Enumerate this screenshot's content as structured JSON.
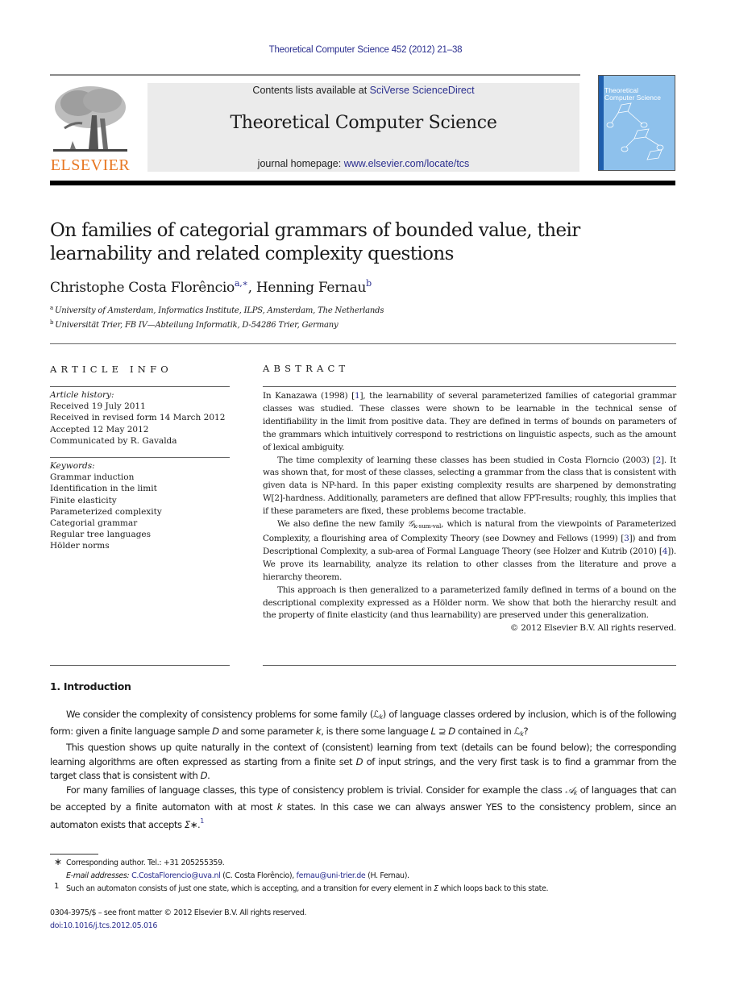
{
  "running_head": "Theoretical Computer Science 452 (2012) 21–38",
  "masthead": {
    "publisher_logo_text": "ELSEVIER",
    "contents_prefix": "Contents lists available at ",
    "contents_link": "SciVerse ScienceDirect",
    "journal_title": "Theoretical Computer Science",
    "homepage_prefix": "journal homepage: ",
    "homepage_link": "www.elsevier.com/locate/tcs",
    "cover_title_line1": "Theoretical",
    "cover_title_line2": "Computer Science",
    "colors": {
      "link": "#2b2f8f",
      "elsevier_orange": "#e87722",
      "banner_bg": "#ebebeb",
      "cover_bg": "#8ec1ec",
      "cover_spine": "#1f5fae"
    }
  },
  "article": {
    "title": "On families of categorial grammars of bounded value, their learnability and related complexity questions",
    "authors": [
      {
        "name": "Christophe Costa Florêncio",
        "marks": "a,∗"
      },
      {
        "name": "Henning Fernau",
        "marks": "b"
      }
    ],
    "author_separator": ", ",
    "affiliations": [
      {
        "mark": "a",
        "text": "University of Amsterdam, Informatics Institute, ILPS, Amsterdam, The Netherlands"
      },
      {
        "mark": "b",
        "text": "Universität Trier, FB IV—Abteilung Informatik, D-54286 Trier, Germany"
      }
    ]
  },
  "article_info": {
    "heading": "ARTICLE INFO",
    "history_label": "Article history:",
    "history": [
      "Received 19 July 2011",
      "Received in revised form 14 March 2012",
      "Accepted 12 May 2012",
      "Communicated by R. Gavalda"
    ],
    "keywords_label": "Keywords:",
    "keywords": [
      "Grammar induction",
      "Identification in the limit",
      "Finite elasticity",
      "Parameterized complexity",
      "Categorial grammar",
      "Regular tree languages",
      "Hölder norms"
    ]
  },
  "abstract": {
    "heading": "ABSTRACT",
    "p1_a": "In Kanazawa (1998) [",
    "p1_ref": "1",
    "p1_b": "], the learnability of several parameterized families of categorial grammar classes was studied. These classes were shown to be learnable in the technical sense of identifiability in the limit from positive data. They are defined in terms of bounds on parameters of the grammars which intuitively correspond to restrictions on linguistic aspects, such as the amount of lexical ambiguity.",
    "p2_a": "The time complexity of learning these classes has been studied in Costa Florncio (2003) [",
    "p2_ref": "2",
    "p2_b": "]. It was shown that, for most of these classes, selecting a grammar from the class that is consistent with given data is NP-hard. In this paper existing complexity results are sharpened by demonstrating W[2]-hardness. Additionally, parameters are defined that allow FPT-results; roughly, this implies that if these parameters are fixed, these problems become tractable.",
    "p3_a": "We also define the new family ",
    "p3_sym": "𝒢",
    "p3_sub": "k-sum-val",
    "p3_b": ", which is natural from the viewpoints of Parameterized Complexity, a flourishing area of Complexity Theory (see Downey and Fellows (1999) [",
    "p3_ref1": "3",
    "p3_c": "]) and from Descriptional Complexity, a sub-area of Formal Language Theory (see Holzer and Kutrib (2010) [",
    "p3_ref2": "4",
    "p3_d": "]). We prove its learnability, analyze its relation to other classes from the literature and prove a hierarchy theorem.",
    "p4": "This approach is then generalized to a parameterized family defined in terms of a bound on the descriptional complexity expressed as a Hölder norm. We show that both the hierarchy result and the property of finite elasticity (and thus learnability) are preserved under this generalization.",
    "copyright": "© 2012 Elsevier B.V. All rights reserved."
  },
  "introduction": {
    "heading": "1.  Introduction",
    "p1_a": "We consider the complexity of consistency problems for some family (",
    "p1_sym1": "ℒ",
    "p1_sub1": "k",
    "p1_b": ") of language classes ordered by inclusion, which is of the following form: given a finite language sample ",
    "p1_D": "D",
    "p1_c": " and some parameter ",
    "p1_k": "k",
    "p1_d": ", is there some language ",
    "p1_L": "L",
    "p1_e": " ⊇ ",
    "p1_D2": "D",
    "p1_f": " contained in ",
    "p1_sym2": "ℒ",
    "p1_sub2": "k",
    "p1_g": "?",
    "p2_a": "This question shows up quite naturally in the context of (consistent) learning from text (details can be found below); the corresponding learning algorithms are often expressed as starting from a finite set ",
    "p2_D": "D",
    "p2_b": " of input strings, and the very first task is to find a grammar from the target class that is consistent with ",
    "p2_D2": "D",
    "p2_c": ".",
    "p3_a": "For many families of language classes, this type of consistency problem is trivial. Consider for example the class ",
    "p3_sym": "𝒜",
    "p3_sub": "k",
    "p3_b": " of languages that can be accepted by a finite automaton with at most ",
    "p3_k": "k",
    "p3_c": " states. In this case we can always answer YES to the consistency problem, since an automaton exists that accepts ",
    "p3_sigma": "Σ∗",
    "p3_d": ".",
    "p3_fn": "1"
  },
  "footnotes": {
    "corresponding_mark": "∗",
    "corresponding": "Corresponding author. Tel.: +31 205255359.",
    "email_label": "E-mail addresses: ",
    "email1": "C.CostaFlorencio@uva.nl",
    "email1_owner": " (C. Costa Florêncio), ",
    "email2": "fernau@uni-trier.de",
    "email2_owner": " (H. Fernau).",
    "fn1_mark": "1",
    "fn1_a": "Such an automaton consists of just one state, which is accepting, and a transition for every element in ",
    "fn1_sym": "Σ",
    "fn1_b": " which loops back to this state."
  },
  "bottom": {
    "issn_line": "0304-3975/$ – see front matter © 2012 Elsevier B.V. All rights reserved.",
    "doi": "doi:10.1016/j.tcs.2012.05.016"
  }
}
